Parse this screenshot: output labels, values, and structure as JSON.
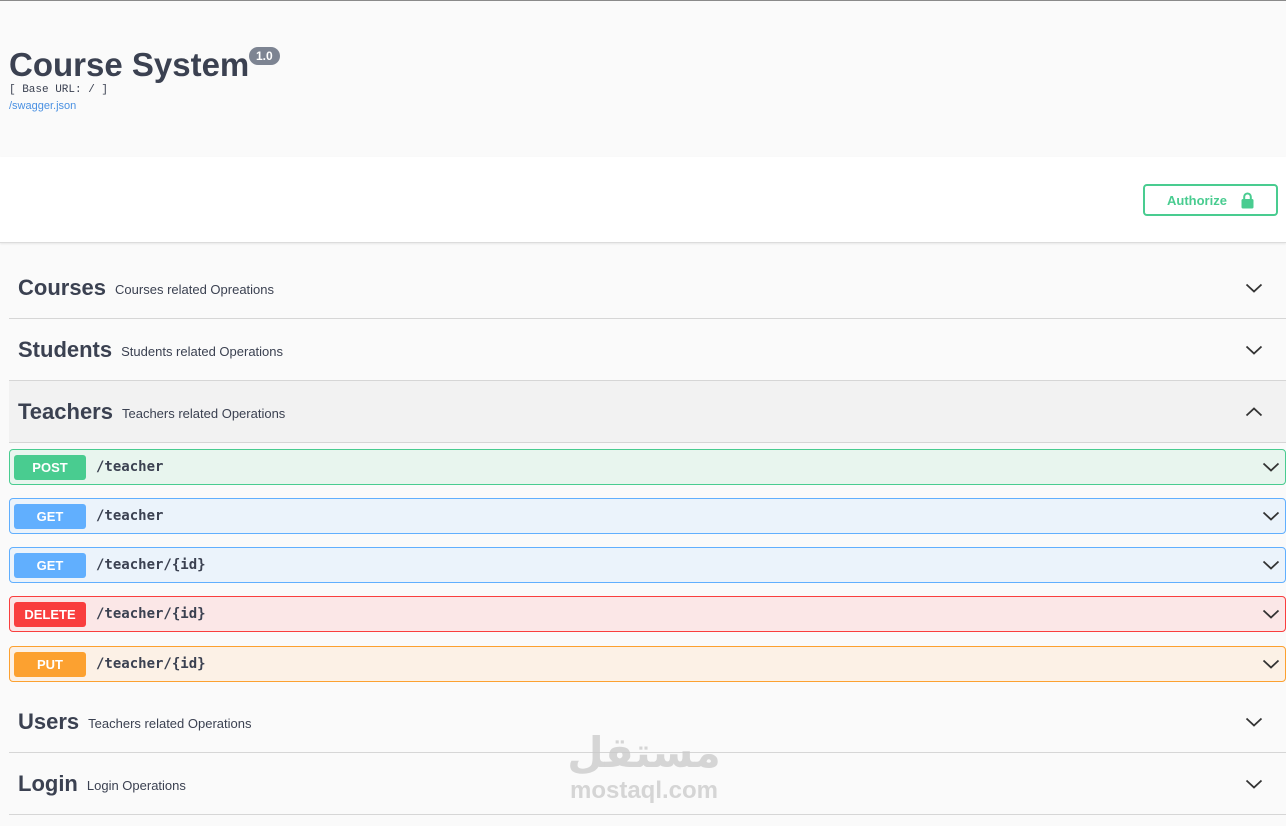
{
  "info": {
    "title": "Course System",
    "version": "1.0",
    "base_url": "[ Base URL: / ]",
    "spec_link": "/swagger.json"
  },
  "scheme": {
    "authorize_label": "Authorize",
    "authorize_icon": "lock-icon"
  },
  "tags": [
    {
      "name": "Courses",
      "description": "Courses related Opreations",
      "expanded": false
    },
    {
      "name": "Students",
      "description": "Students related Operations",
      "expanded": false
    },
    {
      "name": "Teachers",
      "description": "Teachers related Operations",
      "expanded": true
    },
    {
      "name": "Users",
      "description": "Teachers related Operations",
      "expanded": false
    },
    {
      "name": "Login",
      "description": "Login Operations",
      "expanded": false
    }
  ],
  "operations": [
    {
      "method": "POST",
      "path": "/teacher",
      "color": "#49cc90"
    },
    {
      "method": "GET",
      "path": "/teacher",
      "color": "#61affe"
    },
    {
      "method": "GET",
      "path": "/teacher/{id}",
      "color": "#61affe"
    },
    {
      "method": "DELETE",
      "path": "/teacher/{id}",
      "color": "#f93e3e"
    },
    {
      "method": "PUT",
      "path": "/teacher/{id}",
      "color": "#fca130"
    }
  ],
  "watermark": {
    "arabic": "مستقل",
    "latin": "mostaql.com"
  }
}
